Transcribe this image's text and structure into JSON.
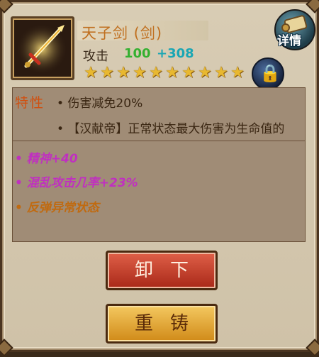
{
  "item": {
    "name": "天子剑 (剑)",
    "stat_label": "攻击",
    "stat_base": "100",
    "stat_bonus": "+308",
    "stars": 10
  },
  "detail_button": {
    "label": "详情",
    "icon": "scroll-icon"
  },
  "lock_button": {
    "icon": "lock-icon"
  },
  "attributes": {
    "title": "特性",
    "lines": [
      "• 伤害减免20%",
      "• 【汉献帝】正常状态最大伤害为生命值的",
      "• 精神+40",
      "• 混乱攻击几率+23%",
      "• 反弹异常状态"
    ]
  },
  "actions": {
    "unequip_label": "卸下",
    "recast_label": "重铸"
  },
  "colors": {
    "name": "#c07020",
    "base_stat": "#34b030",
    "bonus_stat": "#1aa6b4",
    "magic_attr": "#c030c0",
    "special_attr": "#c06a10",
    "unequip_button": "#c03c28",
    "recast_button": "#e8a838"
  }
}
